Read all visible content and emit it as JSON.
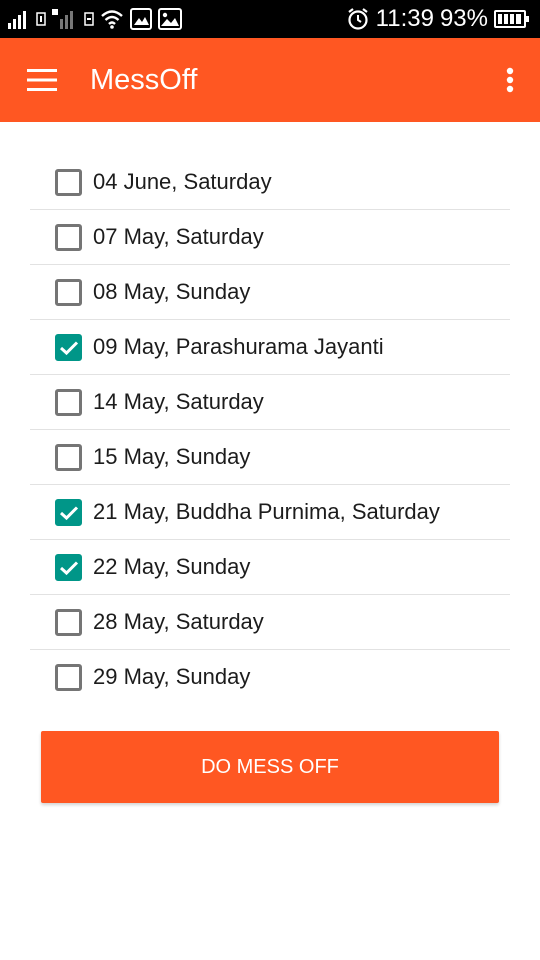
{
  "status_bar": {
    "time": "11:39",
    "battery": "93%",
    "icons": [
      "signal-icon",
      "sim-1-icon",
      "signal-weak-icon",
      "sim-2-icon",
      "wifi-icon",
      "gallery-icon",
      "image-icon",
      "alarm-icon",
      "battery-icon"
    ]
  },
  "app_bar": {
    "title": "MessOff",
    "background": "#ff5722",
    "menu_icon": "menu-icon",
    "overflow_icon": "overflow-menu-icon"
  },
  "dates": [
    {
      "label": "04 June, Saturday",
      "checked": false
    },
    {
      "label": "07 May, Saturday",
      "checked": false
    },
    {
      "label": "08 May, Sunday",
      "checked": false
    },
    {
      "label": "09 May, Parashurama Jayanti",
      "checked": true
    },
    {
      "label": "14 May, Saturday",
      "checked": false
    },
    {
      "label": "15 May, Sunday",
      "checked": false
    },
    {
      "label": "21 May, Buddha Purnima, Saturday",
      "checked": true
    },
    {
      "label": "22 May, Sunday",
      "checked": true
    },
    {
      "label": "28 May, Saturday",
      "checked": false
    },
    {
      "label": "29 May, Sunday",
      "checked": false
    }
  ],
  "checkbox_checked_color": "#009688",
  "action_button": {
    "label": "DO MESS OFF"
  }
}
